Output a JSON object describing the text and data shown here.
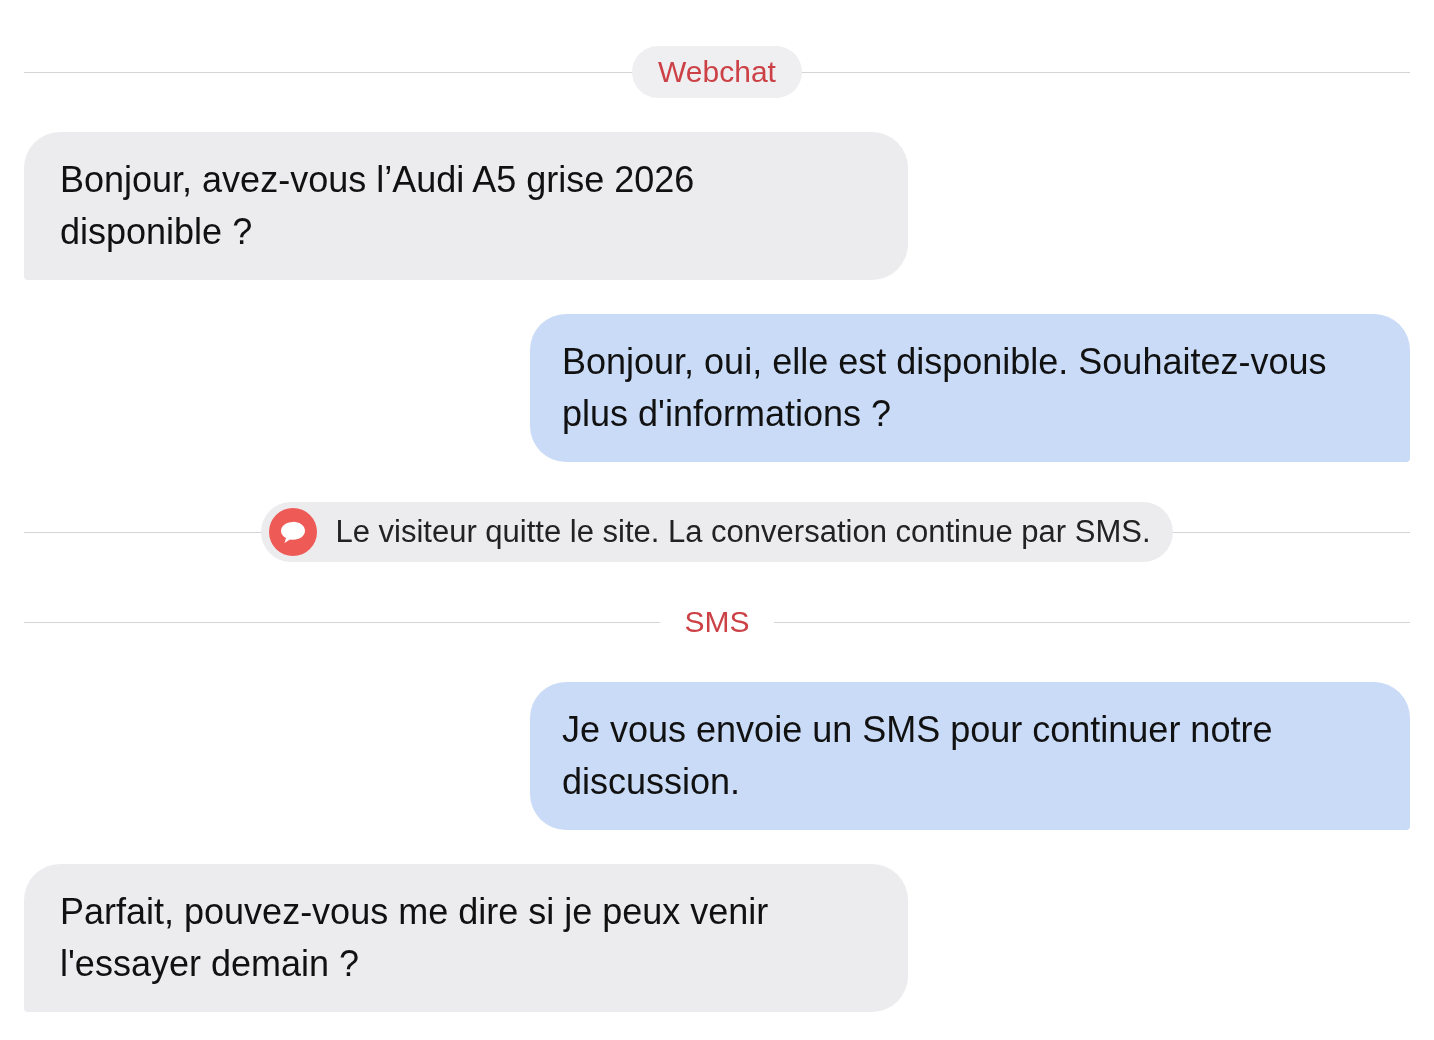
{
  "conversation": [
    {
      "kind": "channel",
      "label": "Webchat",
      "boxed": true
    },
    {
      "kind": "message",
      "outgoing": false,
      "text": "Bonjour, avez-vous l’Audi A5 grise 2026 disponible ?"
    },
    {
      "kind": "message",
      "outgoing": true,
      "text": "Bonjour, oui, elle est disponible. Souhaitez-vous plus d'informations ?"
    },
    {
      "kind": "notice",
      "text": "Le visiteur quitte le site. La conversation continue par SMS."
    },
    {
      "kind": "channel",
      "label": "SMS",
      "boxed": false
    },
    {
      "kind": "message",
      "outgoing": true,
      "text": "Je vous envoie un SMS pour continuer notre discussion."
    },
    {
      "kind": "message",
      "outgoing": false,
      "text": "Parfait, pouvez-vous me dire si je peux venir l'essayer demain ?"
    }
  ]
}
